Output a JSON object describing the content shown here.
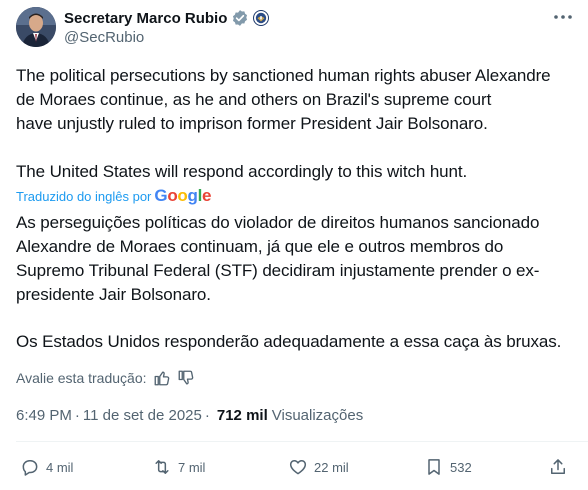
{
  "author": {
    "name": "Secretary Marco Rubio",
    "handle": "@SecRubio"
  },
  "tweet": {
    "paragraphs": [
      "The political persecutions by sanctioned human rights abuser Alexandre\nde Moraes continue, as he and others on Brazil's supreme court\nhave unjustly ruled to imprison former President Jair Bolsonaro.",
      "The United States will respond accordingly to this witch hunt."
    ]
  },
  "translation": {
    "label": "Traduzido do inglês por",
    "provider": "Google",
    "paragraphs": [
      "As perseguições políticas do violador de direitos humanos sancionado\nAlexandre de Moraes continuam, já que ele e outros membros do\nSupremo Tribunal Federal (STF) decidiram injustamente prender o ex-\npresidente Jair Bolsonaro.",
      "Os Estados Unidos responderão adequadamente a essa caça às bruxas."
    ],
    "rate_label": "Avalie esta tradução:"
  },
  "meta": {
    "time": "6:49 PM",
    "date": "11 de set de 2025",
    "views": "712 mil",
    "views_label": "Visualizações"
  },
  "actions": {
    "replies": "4 mil",
    "reposts": "7 mil",
    "likes": "22 mil",
    "bookmarks": "532"
  },
  "colors": {
    "accent": "#1d9bf0",
    "verified_badge": "#829aab",
    "text": "#0f1419",
    "muted": "#536471"
  }
}
